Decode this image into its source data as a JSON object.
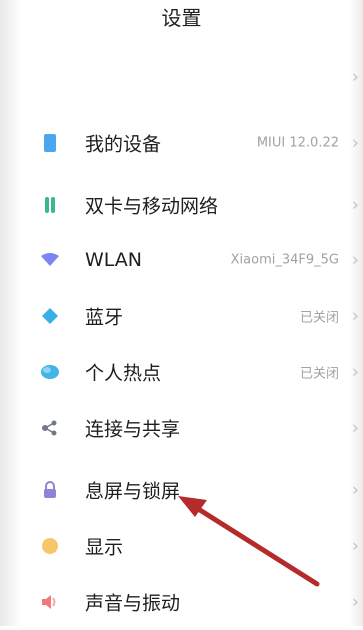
{
  "header": {
    "title": "设置"
  },
  "settings": [
    {
      "label": "我的设备",
      "value": "MIUI 12.0.22",
      "icon": "phone-icon",
      "color": "#4aa6ee"
    },
    {
      "label": "双卡与移动网络",
      "value": "",
      "icon": "sim-dual-icon",
      "color": "#39b88a"
    },
    {
      "label": "WLAN",
      "value": "Xiaomi_34F9_5G",
      "icon": "wifi-icon",
      "color": "#7b86f2"
    },
    {
      "label": "蓝牙",
      "value": "已关闭",
      "icon": "bluetooth-icon",
      "color": "#3aaee6"
    },
    {
      "label": "个人热点",
      "value": "已关闭",
      "icon": "hotspot-icon",
      "color": "#41b4e8"
    },
    {
      "label": "连接与共享",
      "value": "",
      "icon": "share-icon",
      "color": "#6f7a86"
    },
    {
      "label": "息屏与锁屏",
      "value": "",
      "icon": "lock-icon",
      "color": "#8d84d8"
    },
    {
      "label": "显示",
      "value": "",
      "icon": "display-icon",
      "color": "#f7c66a"
    },
    {
      "label": "声音与振动",
      "value": "",
      "icon": "sound-icon",
      "color": "#ef7a7a"
    }
  ],
  "annotation": {
    "icon": "red-arrow-icon",
    "color": "#b52a2a"
  }
}
